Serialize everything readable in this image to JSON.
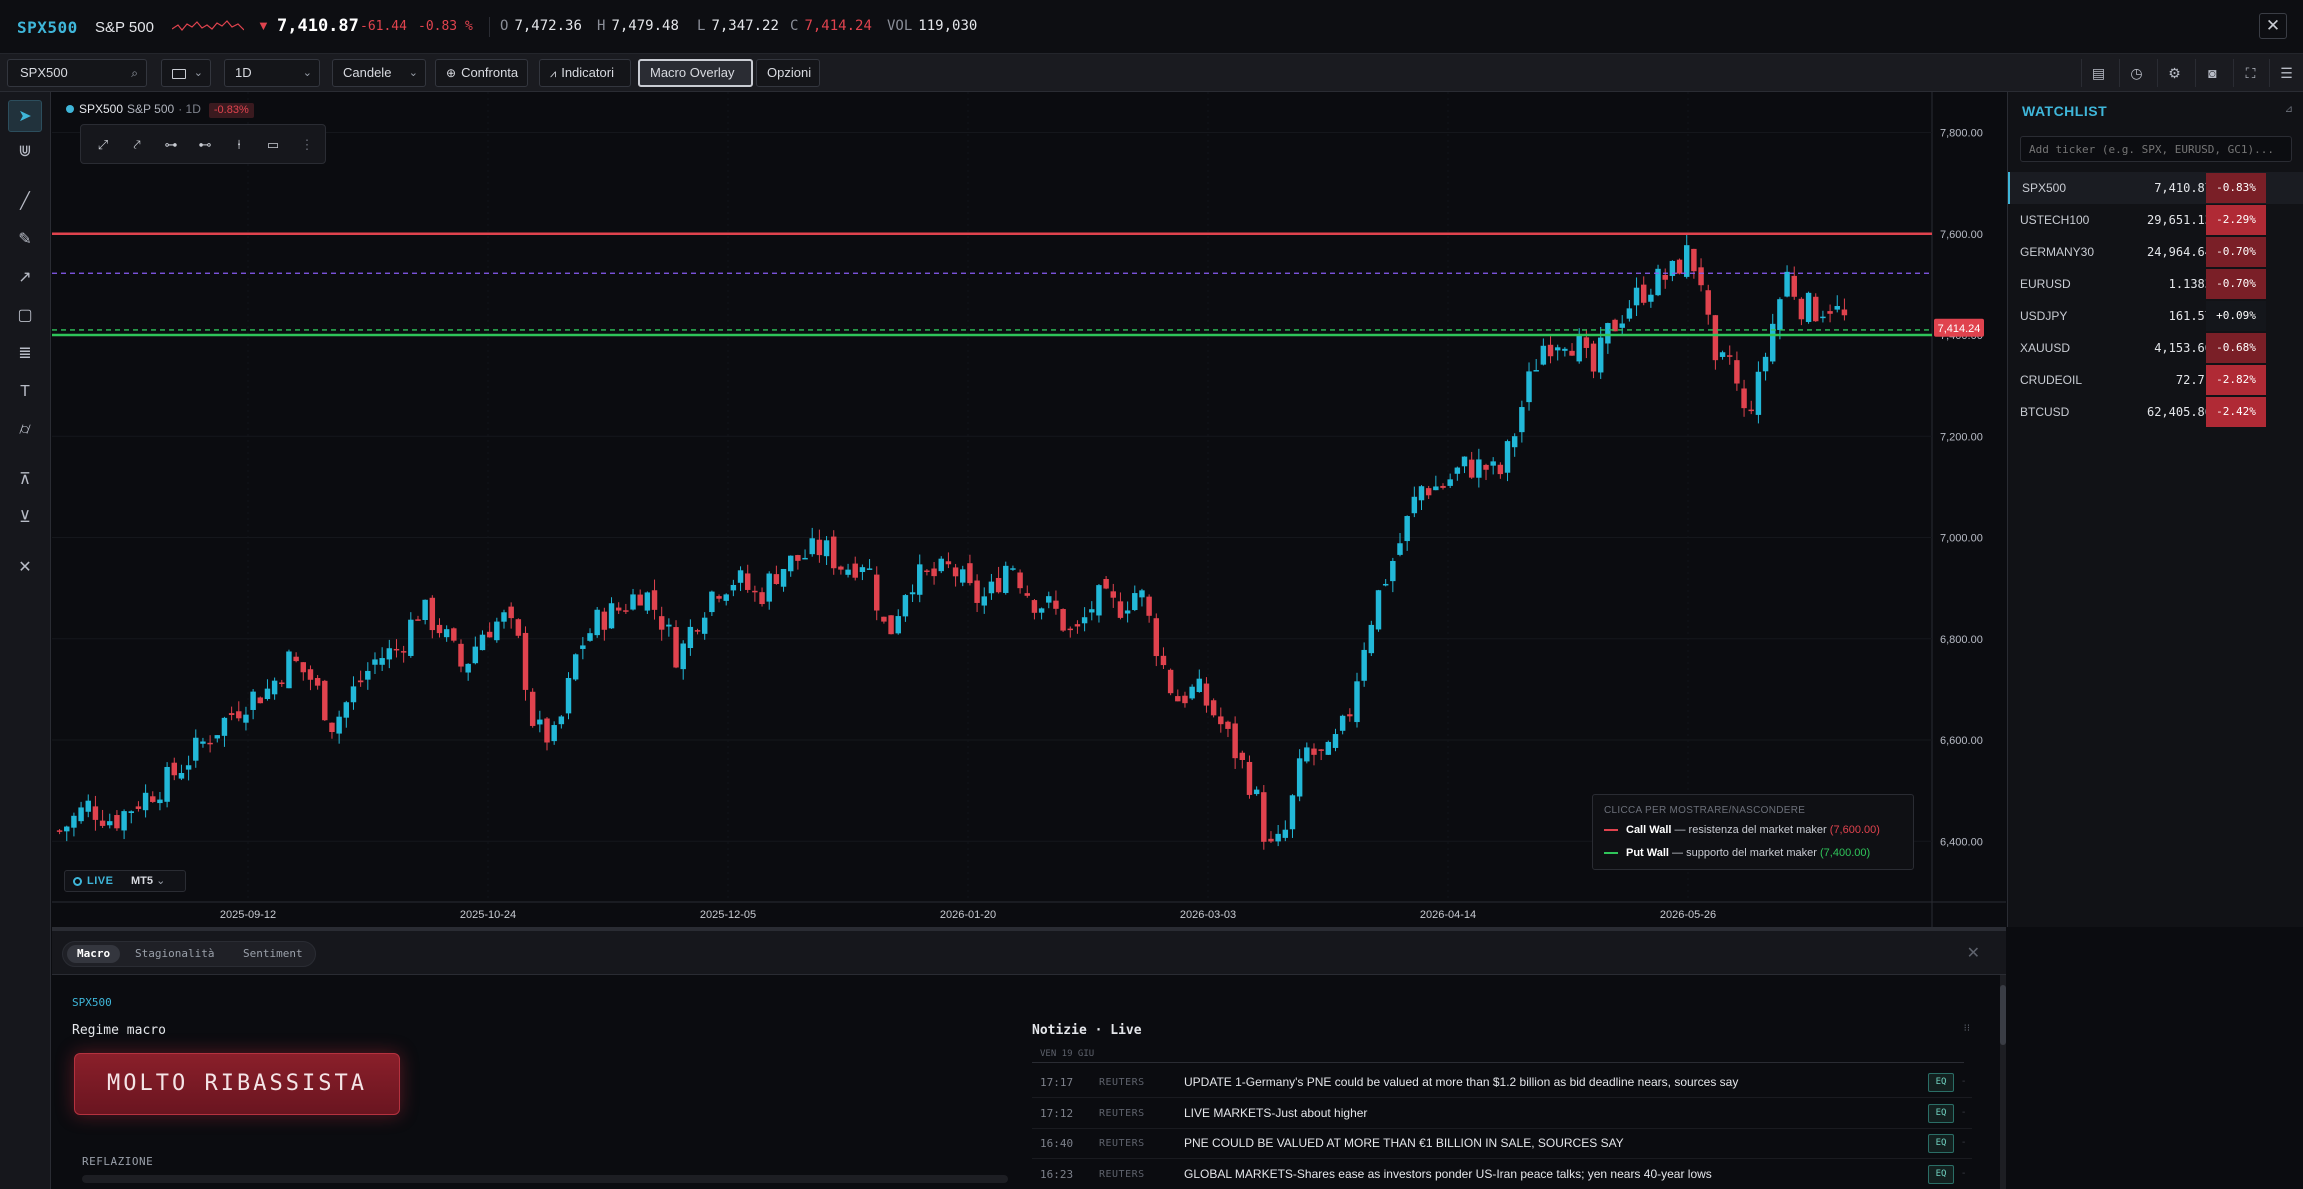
{
  "quote": {
    "symbol": "SPX500",
    "name": "S&P 500",
    "direction_arrow": "▼",
    "last": "7,410.87",
    "change": "-61.44",
    "change_pct": "-0.83 %",
    "open_label": "O",
    "open": "7,472.36",
    "high_label": "H",
    "high": "7,479.48",
    "low_label": "L",
    "low": "7,347.22",
    "close_label": "C",
    "close": "7,414.24",
    "vol_label": "VOL",
    "vol": "119,030",
    "close_icon": "close-icon"
  },
  "toolbar": {
    "symbol_value": "SPX500",
    "timeframe": "1D",
    "chart_type": "Candele",
    "compare": "Confronta",
    "indicators": "Indicatori",
    "macro_overlay": "Macro Overlay",
    "options": "Opzioni",
    "right_icons": [
      "layout-icon",
      "clock-icon",
      "gear-icon",
      "camera-icon",
      "fullscreen-icon",
      "menu-icon"
    ]
  },
  "left_tools": [
    "cursor-icon",
    "magnet-icon",
    "trendline-icon",
    "pencil-icon",
    "arrow-icon",
    "rectangle-icon",
    "fibonacci-icon",
    "text-icon",
    "ruler-icon",
    "long-position-icon",
    "short-position-icon",
    "remove-drawings-icon"
  ],
  "chart_legend": {
    "symbol": "SPX500",
    "name": "S&P 500",
    "timeframe": "· 1D",
    "change_pct": "-0.83%"
  },
  "draw_tools": [
    "segment-icon",
    "ray-icon",
    "hline-icon",
    "hray-icon",
    "vline-icon",
    "rect-icon",
    "more-icon"
  ],
  "live": {
    "label": "LIVE",
    "source": "MT5"
  },
  "walls": {
    "header": "CLICCA PER MOSTRARE/NASCONDERE",
    "call_name": "Call Wall",
    "call_desc": " — resistenza del market maker ",
    "call_value": "(7,600.00)",
    "call_color": "#e0434e",
    "put_name": "Put Wall",
    "put_desc": " — supporto del market maker ",
    "put_value": "(7,400.00)",
    "put_color": "#2fc45a"
  },
  "chart_data": {
    "type": "candlestick",
    "symbol": "SPX500",
    "timeframe": "1D",
    "y_ticks": [
      "6,400.00",
      "6,600.00",
      "6,800.00",
      "7,000.00",
      "7,200.00",
      "7,400.00",
      "7,600.00",
      "7,800.00"
    ],
    "ylim": [
      6280,
      7880
    ],
    "x_ticks": [
      "2025-09-12",
      "2025-10-24",
      "2025-12-05",
      "2026-01-20",
      "2026-03-03",
      "2026-04-14",
      "2026-05-26"
    ],
    "last_price_label": "7,414.24",
    "last_price": 7414.24,
    "levels": [
      {
        "name": "Call Wall",
        "value": 7600.0,
        "color": "#e0434e",
        "style": "solid"
      },
      {
        "name": "Put Wall",
        "value": 7400.0,
        "color": "#2fc45a",
        "style": "solid"
      },
      {
        "name": "dashed-purple",
        "value": 7522,
        "color": "#8a5cf6",
        "style": "dashed"
      },
      {
        "name": "dashed-green",
        "value": 7410,
        "color": "#2fc45a",
        "style": "dashed"
      }
    ],
    "up_color": "#22b8d8",
    "down_color": "#e0434e",
    "close_path": [
      [
        0,
        6420
      ],
      [
        8,
        6470
      ],
      [
        15,
        6440
      ],
      [
        22,
        6480
      ],
      [
        30,
        6520
      ],
      [
        38,
        6580
      ],
      [
        46,
        6640
      ],
      [
        52,
        6680
      ],
      [
        58,
        6700
      ],
      [
        64,
        6760
      ],
      [
        70,
        6720
      ],
      [
        76,
        6630
      ],
      [
        82,
        6700
      ],
      [
        88,
        6760
      ],
      [
        94,
        6780
      ],
      [
        100,
        6860
      ],
      [
        106,
        6820
      ],
      [
        112,
        6740
      ],
      [
        118,
        6820
      ],
      [
        124,
        6840
      ],
      [
        128,
        6780
      ],
      [
        132,
        6620
      ],
      [
        138,
        6600
      ],
      [
        144,
        6780
      ],
      [
        150,
        6840
      ],
      [
        156,
        6860
      ],
      [
        162,
        6900
      ],
      [
        168,
        6830
      ],
      [
        172,
        6760
      ],
      [
        176,
        6830
      ],
      [
        182,
        6900
      ],
      [
        188,
        6920
      ],
      [
        194,
        6880
      ],
      [
        200,
        6940
      ],
      [
        206,
        6960
      ],
      [
        212,
        6980
      ],
      [
        218,
        6940
      ],
      [
        224,
        6960
      ],
      [
        230,
        6800
      ],
      [
        236,
        6920
      ],
      [
        242,
        6920
      ],
      [
        248,
        6940
      ],
      [
        254,
        6880
      ],
      [
        258,
        6880
      ],
      [
        264,
        6960
      ],
      [
        270,
        6880
      ],
      [
        276,
        6860
      ],
      [
        282,
        6800
      ],
      [
        288,
        6880
      ],
      [
        294,
        6860
      ],
      [
        300,
        6900
      ],
      [
        306,
        6760
      ],
      [
        310,
        6680
      ],
      [
        316,
        6700
      ],
      [
        322,
        6640
      ],
      [
        328,
        6560
      ],
      [
        332,
        6500
      ],
      [
        336,
        6380
      ],
      [
        340,
        6400
      ],
      [
        346,
        6580
      ],
      [
        352,
        6560
      ],
      [
        358,
        6640
      ],
      [
        362,
        6780
      ],
      [
        366,
        6880
      ],
      [
        372,
        6980
      ],
      [
        378,
        7100
      ],
      [
        384,
        7100
      ],
      [
        390,
        7140
      ],
      [
        396,
        7140
      ],
      [
        400,
        7120
      ],
      [
        404,
        7200
      ],
      [
        408,
        7300
      ],
      [
        412,
        7380
      ],
      [
        418,
        7400
      ],
      [
        422,
        7380
      ],
      [
        426,
        7320
      ],
      [
        430,
        7400
      ],
      [
        436,
        7460
      ],
      [
        442,
        7500
      ],
      [
        448,
        7520
      ],
      [
        452,
        7560
      ],
      [
        456,
        7520
      ],
      [
        460,
        7320
      ],
      [
        464,
        7360
      ],
      [
        468,
        7240
      ],
      [
        472,
        7300
      ],
      [
        476,
        7420
      ],
      [
        480,
        7520
      ],
      [
        484,
        7460
      ],
      [
        488,
        7450
      ],
      [
        492,
        7460
      ],
      [
        496,
        7430
      ]
    ],
    "x_index_max": 496
  },
  "watchlist": {
    "title": "WATCHLIST",
    "pin_icon": "pin-icon",
    "placeholder": "Add ticker (e.g. SPX, EURUSD, GC1)...",
    "rows": [
      {
        "symbol": "SPX500",
        "price": "7,410.87",
        "change": "-0.83%",
        "color": "#7a1f27"
      },
      {
        "symbol": "USTECH100",
        "price": "29,651.13",
        "change": "-2.29%",
        "color": "#b02a35"
      },
      {
        "symbol": "GERMANY30",
        "price": "24,964.64",
        "change": "-0.70%",
        "color": "#7a1f27"
      },
      {
        "symbol": "EURUSD",
        "price": "1.1383",
        "change": "-0.70%",
        "color": "#7a1f27"
      },
      {
        "symbol": "USDJPY",
        "price": "161.57",
        "change": "+0.09%",
        "color": "#14161b"
      },
      {
        "symbol": "XAUUSD",
        "price": "4,153.60",
        "change": "-0.68%",
        "color": "#7a1f27"
      },
      {
        "symbol": "CRUDEOIL",
        "price": "72.71",
        "change": "-2.82%",
        "color": "#b02a35"
      },
      {
        "symbol": "BTCUSD",
        "price": "62,405.86",
        "change": "-2.42%",
        "color": "#b02a35"
      }
    ]
  },
  "bottom": {
    "tabs": [
      "Macro",
      "Stagionalità",
      "Sentiment"
    ],
    "active_tab": "Macro",
    "close_icon": "close-icon",
    "symbol": "SPX500",
    "regime_title": "Regime macro",
    "regime_value": "MOLTO RIBASSISTA",
    "reflation_label": "REFLAZIONE",
    "news_title": "Notizie · Live",
    "news_date": "VEN 19 GIU",
    "news": [
      {
        "time": "17:17",
        "source": "REUTERS",
        "headline": "UPDATE 1-Germany's PNE could be valued at more than $1.2 billion as bid deadline nears, sources say",
        "tag": "EQ"
      },
      {
        "time": "17:12",
        "source": "REUTERS",
        "headline": "LIVE MARKETS-Just about higher",
        "tag": "EQ"
      },
      {
        "time": "16:40",
        "source": "REUTERS",
        "headline": "PNE COULD BE VALUED AT MORE THAN €1 BILLION IN SALE, SOURCES SAY",
        "tag": "EQ"
      },
      {
        "time": "16:23",
        "source": "REUTERS",
        "headline": "GLOBAL MARKETS-Shares ease as investors ponder US-Iran peace talks; yen nears 40-year lows",
        "tag": "EQ"
      }
    ]
  }
}
